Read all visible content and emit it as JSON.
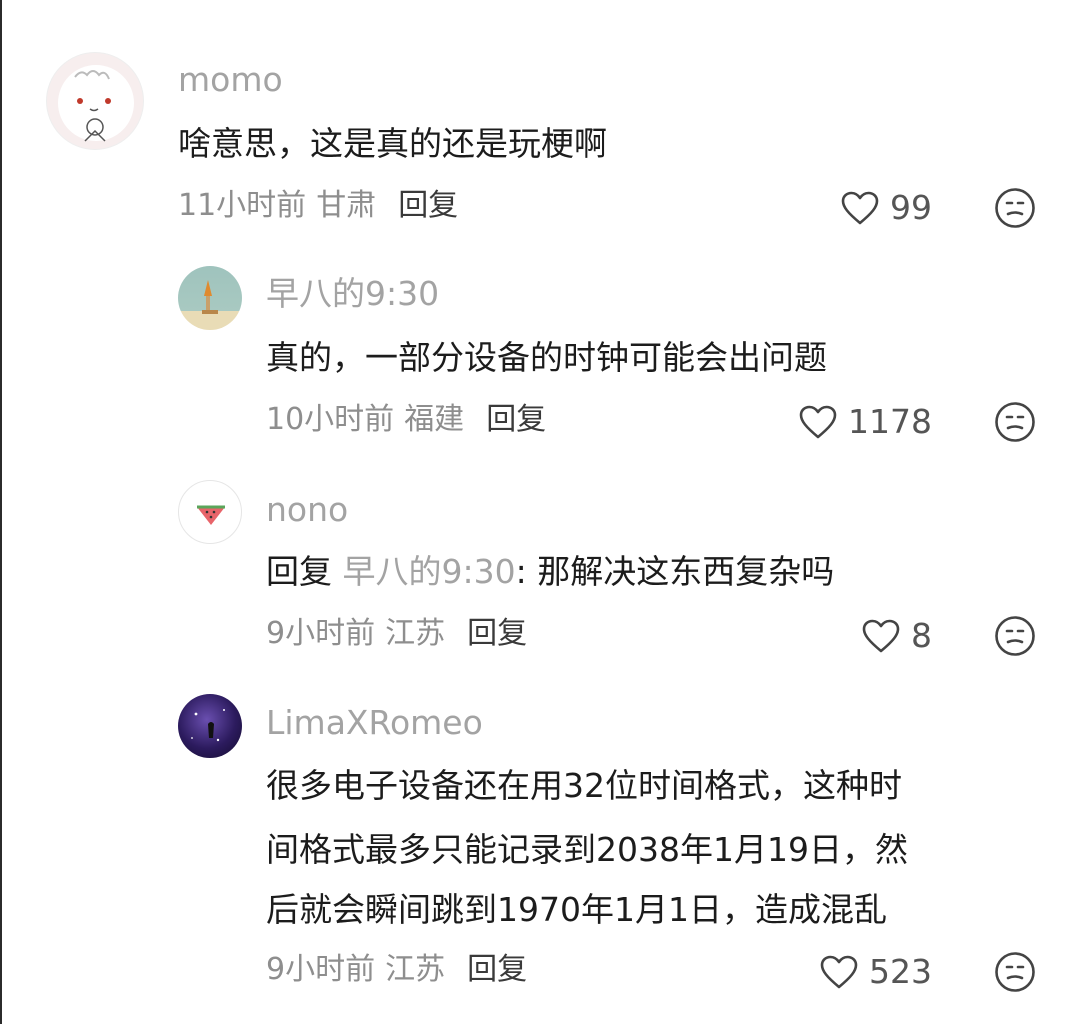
{
  "comments": [
    {
      "username": "momo",
      "text": "啥意思，这是真的还是玩梗啊",
      "time": "11小时前",
      "location": "甘肃",
      "reply_label": "回复",
      "likes": "99"
    },
    {
      "username": "早八的9:30",
      "text": "真的，一部分设备的时钟可能会出问题",
      "time": "10小时前",
      "location": "福建",
      "reply_label": "回复",
      "likes": "1178"
    },
    {
      "username": "nono",
      "reply_prefix": "回复",
      "reply_target": "早八的9:30",
      "text": ": 那解决这东西复杂吗",
      "time": "9小时前",
      "location": "江苏",
      "reply_label": "回复",
      "likes": "8"
    },
    {
      "username": "LimaXRomeo",
      "text_lines": [
        "很多电子设备还在用32位时间格式，这种时",
        "间格式最多只能记录到2038年1月19日，然",
        "后就会瞬间跳到1970年1月1日，造成混乱"
      ],
      "time": "9小时前",
      "location": "江苏",
      "reply_label": "回复",
      "likes": "523"
    }
  ],
  "icons": {
    "like": "heart-outline-icon",
    "dislike": "meh-face-icon"
  }
}
